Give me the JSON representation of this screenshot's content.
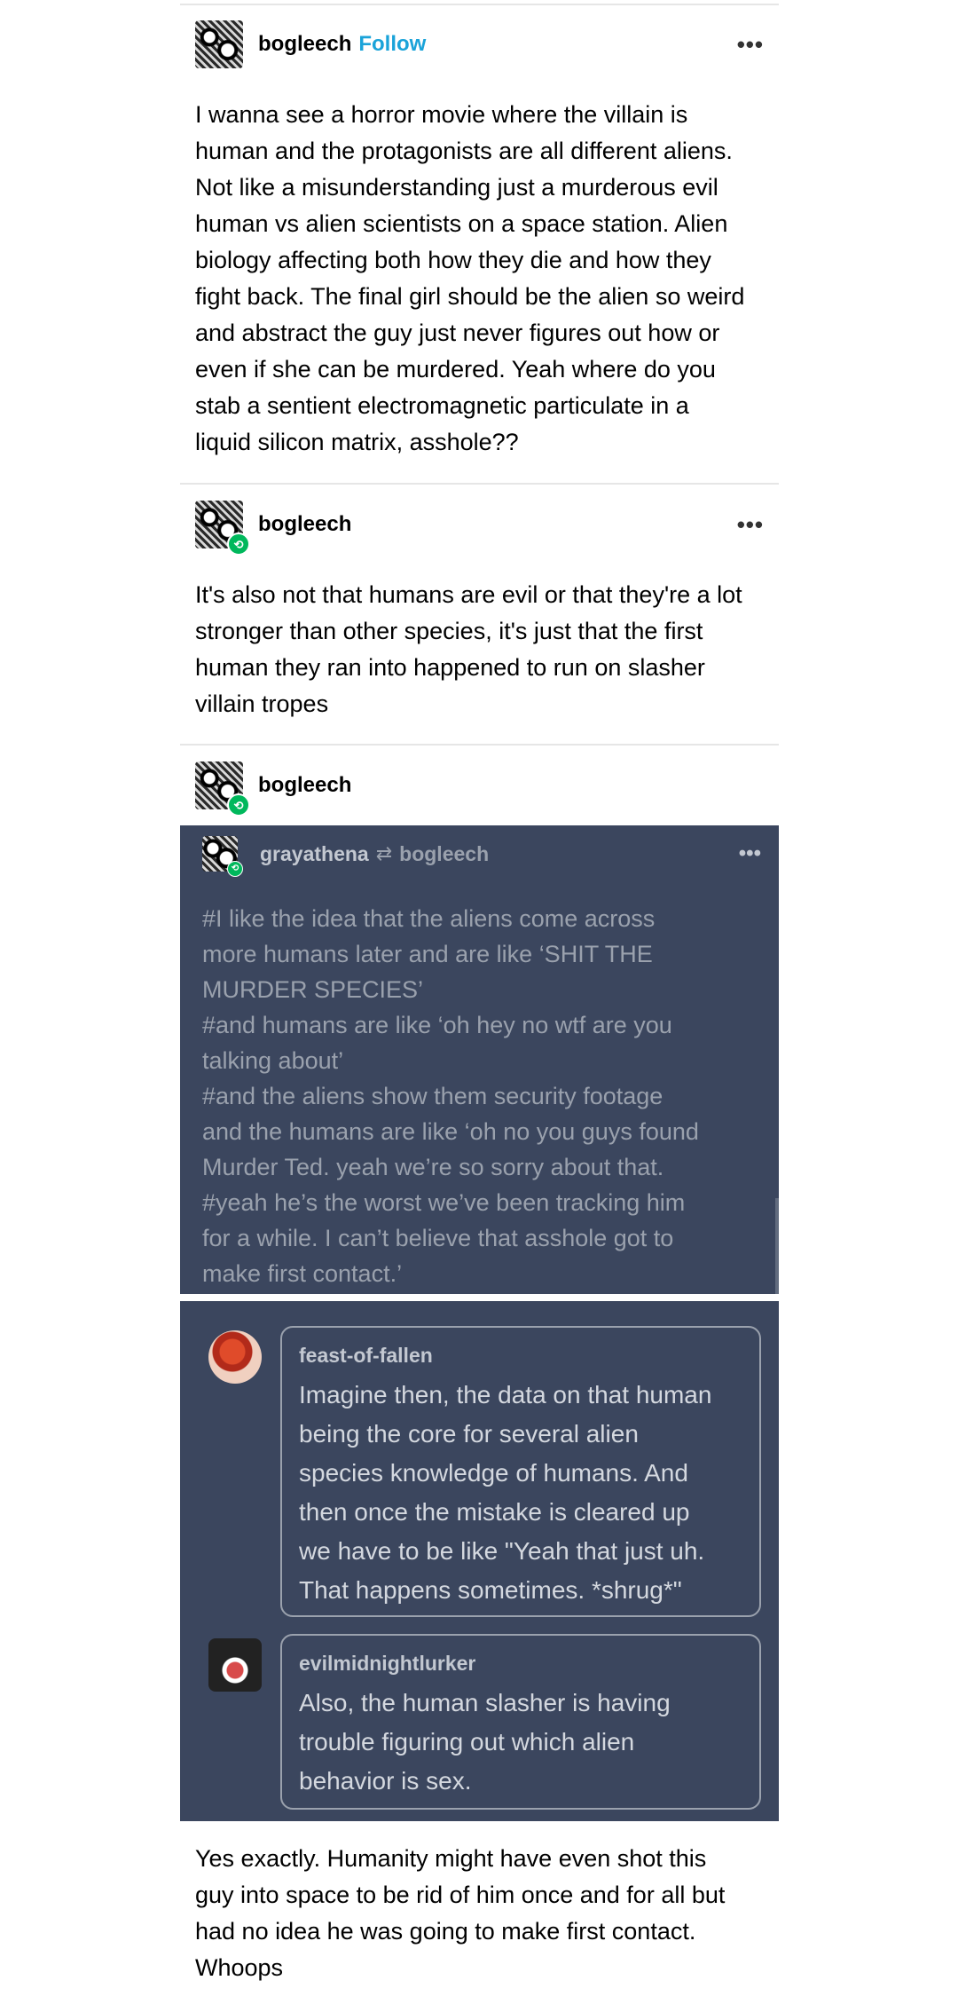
{
  "post1": {
    "username": "bogleech",
    "follow_label": "Follow",
    "more_icon": "more-horizontal-icon",
    "lines": [
      "I wanna see a horror movie where the villain is",
      "human and the protagonists are all different aliens.",
      "Not like a misunderstanding just a murderous evil",
      "human vs alien scientists on a space station. Alien",
      "biology affecting both how they die and how they",
      "fight back. The final girl should be the alien so weird",
      "and abstract the guy just never figures out how or",
      "even if she can be murdered. Yeah where do you",
      "stab a sentient electromagnetic particulate in a",
      "liquid silicon matrix, asshole??"
    ]
  },
  "post2": {
    "username": "bogleech",
    "more_icon": "more-horizontal-icon",
    "lines": [
      "It's also not that humans are evil or that they're a lot",
      "stronger than other species, it's just that the first",
      "human they ran into happened to run on slasher",
      "villain tropes"
    ]
  },
  "post3": {
    "username": "bogleech"
  },
  "embedded": {
    "username": "grayathena",
    "reblog_icon": "reblog-icon",
    "source_username": "bogleech",
    "more_icon": "more-horizontal-icon",
    "tag_lines": [
      "#I like the idea that the aliens come across",
      "more humans later and are like ‘SHIT THE",
      "MURDER SPECIES’",
      "#and humans are like ‘oh hey no wtf are you",
      "talking about’",
      "#and the aliens show them security footage",
      "and the humans are like ‘oh no you guys found",
      "Murder Ted. yeah we’re so sorry about that.",
      "#yeah he’s the worst we’ve been tracking him",
      "for a while. I can’t believe that asshole got to",
      "make first contact.’"
    ]
  },
  "comments": [
    {
      "username": "feast-of-fallen",
      "lines": [
        "Imagine then, the data on that human",
        "being the core for several alien",
        "species knowledge of humans. And",
        "then once the mistake is cleared up",
        "we have to be like \"Yeah that just uh.",
        "That happens sometimes. *shrug*\""
      ]
    },
    {
      "username": "evilmidnightlurker",
      "lines": [
        "Also, the human slasher is having",
        "trouble figuring out which alien",
        "behavior is sex."
      ]
    }
  ],
  "post3_body": {
    "lines": [
      "Yes exactly. Humanity might have even shot this",
      "guy into space to be rid of him once and for all but",
      "had no idea he was going to make first contact.",
      "Whoops"
    ]
  },
  "colors": {
    "follow": "#1aa3d9",
    "dark_panel": "#3b465e",
    "reblog_badge": "#00b85c"
  }
}
